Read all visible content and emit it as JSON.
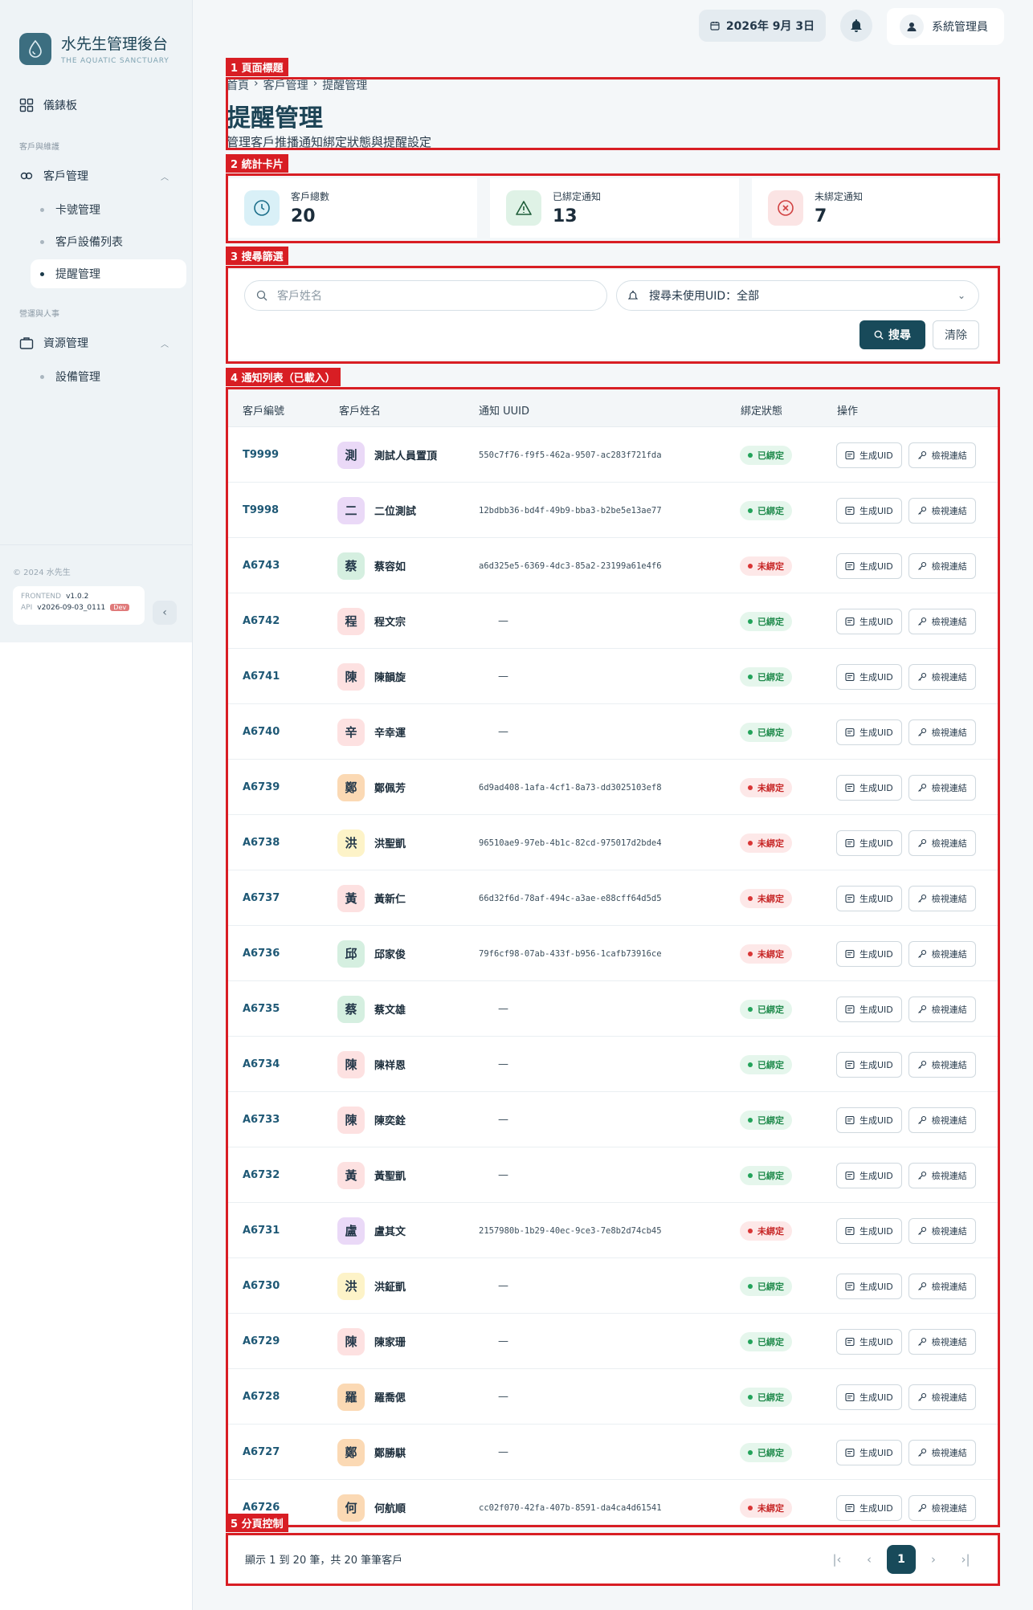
{
  "brand": {
    "title": "水先生管理後台",
    "subtitle": "THE AQUATIC SANCTUARY"
  },
  "nav": {
    "dashboard": "儀錶板",
    "section1": "客戶與維護",
    "customer_mgmt": "客戶管理",
    "card_mgmt": "卡號管理",
    "device_list": "客戶設備列表",
    "reminder_mgmt": "提醒管理",
    "section2": "營運與人事",
    "resource_mgmt": "資源管理",
    "equipment_mgmt": "設備管理"
  },
  "footer": {
    "copyright": "© 2024 水先生",
    "frontend_label": "FRONTEND",
    "frontend_version": "v1.0.2",
    "api_label": "API",
    "api_version": "v2026-09-03_0111",
    "env_badge": "Dev"
  },
  "topbar": {
    "date": "2026年 9月 3日",
    "user": "系統管理員"
  },
  "annotations": {
    "a1": "1 頁面標題",
    "a2": "2 統計卡片",
    "a3": "3 搜尋篩選",
    "a4": "4 通知列表（已載入）",
    "a5": "5 分頁控制"
  },
  "header": {
    "breadcrumb": [
      "首頁",
      "客戶管理",
      "提醒管理"
    ],
    "title": "提醒管理",
    "subtitle": "管理客戶推播通知綁定狀態與提醒設定"
  },
  "stats": [
    {
      "label": "客戶總數",
      "value": "20",
      "color": "#3aa5c6",
      "bg": "#d9f0f7"
    },
    {
      "label": "已綁定通知",
      "value": "13",
      "color": "#2f8a55",
      "bg": "#dff2e6"
    },
    {
      "label": "未綁定通知",
      "value": "7",
      "color": "#d14141",
      "bg": "#fbe4e4"
    }
  ],
  "filter": {
    "search_placeholder": "客戶姓名",
    "select_value": "搜尋未使用UID：全部",
    "search_button": "搜尋",
    "clear_button": "清除"
  },
  "table": {
    "headers": [
      "客戶編號",
      "客戶姓名",
      "通知 UUID",
      "綁定狀態",
      "操作"
    ],
    "action_generate": "生成UID",
    "action_view": "檢視連結",
    "rows": [
      {
        "id": "T9999",
        "initial": "測",
        "name": "測試人員置頂",
        "uuid": "550c7f76-f9f5-462a-9507-ac283f721fda",
        "status": "已綁定",
        "bound": true,
        "avatar_bg": "#ead9f7"
      },
      {
        "id": "T9998",
        "initial": "二",
        "name": "二位測試",
        "uuid": "12bdbb36-bd4f-49b9-bba3-b2be5e13ae77",
        "status": "已綁定",
        "bound": true,
        "avatar_bg": "#ead9f7"
      },
      {
        "id": "A6743",
        "initial": "蔡",
        "name": "蔡容如",
        "uuid": "a6d325e5-6369-4dc3-85a2-23199a61e4f6",
        "status": "未綁定",
        "bound": false,
        "avatar_bg": "#d5efe0"
      },
      {
        "id": "A6742",
        "initial": "程",
        "name": "程文宗",
        "uuid": "—",
        "status": "已綁定",
        "bound": true,
        "avatar_bg": "#fde1e1"
      },
      {
        "id": "A6741",
        "initial": "陳",
        "name": "陳韻旋",
        "uuid": "—",
        "status": "已綁定",
        "bound": true,
        "avatar_bg": "#fde1e1"
      },
      {
        "id": "A6740",
        "initial": "辛",
        "name": "辛幸運",
        "uuid": "—",
        "status": "已綁定",
        "bound": true,
        "avatar_bg": "#fde1e1"
      },
      {
        "id": "A6739",
        "initial": "鄭",
        "name": "鄭佩芳",
        "uuid": "6d9ad408-1afa-4cf1-8a73-dd3025103ef8",
        "status": "未綁定",
        "bound": false,
        "avatar_bg": "#fbd9b4"
      },
      {
        "id": "A6738",
        "initial": "洪",
        "name": "洪聖凱",
        "uuid": "96510ae9-97eb-4b1c-82cd-975017d2bde4",
        "status": "未綁定",
        "bound": false,
        "avatar_bg": "#fdf3c8"
      },
      {
        "id": "A6737",
        "initial": "黃",
        "name": "黃新仁",
        "uuid": "66d32f6d-78af-494c-a3ae-e88cff64d5d5",
        "status": "未綁定",
        "bound": false,
        "avatar_bg": "#fde1e1"
      },
      {
        "id": "A6736",
        "initial": "邱",
        "name": "邱家俊",
        "uuid": "79f6cf98-07ab-433f-b956-1cafb73916ce",
        "status": "未綁定",
        "bound": false,
        "avatar_bg": "#d5efe0"
      },
      {
        "id": "A6735",
        "initial": "蔡",
        "name": "蔡文雄",
        "uuid": "—",
        "status": "已綁定",
        "bound": true,
        "avatar_bg": "#d5efe0"
      },
      {
        "id": "A6734",
        "initial": "陳",
        "name": "陳祥恩",
        "uuid": "—",
        "status": "已綁定",
        "bound": true,
        "avatar_bg": "#fde1e1"
      },
      {
        "id": "A6733",
        "initial": "陳",
        "name": "陳奕銓",
        "uuid": "—",
        "status": "已綁定",
        "bound": true,
        "avatar_bg": "#fde1e1"
      },
      {
        "id": "A6732",
        "initial": "黃",
        "name": "黃聖凱",
        "uuid": "—",
        "status": "已綁定",
        "bound": true,
        "avatar_bg": "#fde1e1"
      },
      {
        "id": "A6731",
        "initial": "盧",
        "name": "盧其文",
        "uuid": "2157980b-1b29-40ec-9ce3-7e8b2d74cb45",
        "status": "未綁定",
        "bound": false,
        "avatar_bg": "#ead9f7"
      },
      {
        "id": "A6730",
        "initial": "洪",
        "name": "洪鉦凱",
        "uuid": "—",
        "status": "已綁定",
        "bound": true,
        "avatar_bg": "#fdf3c8"
      },
      {
        "id": "A6729",
        "initial": "陳",
        "name": "陳家珊",
        "uuid": "—",
        "status": "已綁定",
        "bound": true,
        "avatar_bg": "#fde1e1"
      },
      {
        "id": "A6728",
        "initial": "羅",
        "name": "羅喬偲",
        "uuid": "—",
        "status": "已綁定",
        "bound": true,
        "avatar_bg": "#fbd9b4"
      },
      {
        "id": "A6727",
        "initial": "鄭",
        "name": "鄭勝騏",
        "uuid": "—",
        "status": "已綁定",
        "bound": true,
        "avatar_bg": "#fbd9b4"
      },
      {
        "id": "A6726",
        "initial": "何",
        "name": "何航順",
        "uuid": "cc02f070-42fa-407b-8591-da4ca4d61541",
        "status": "未綁定",
        "bound": false,
        "avatar_bg": "#fbd9b4"
      }
    ]
  },
  "pagination": {
    "summary": "顯示 1 到 20 筆，共 20 筆筆客戶",
    "current_page": "1"
  }
}
